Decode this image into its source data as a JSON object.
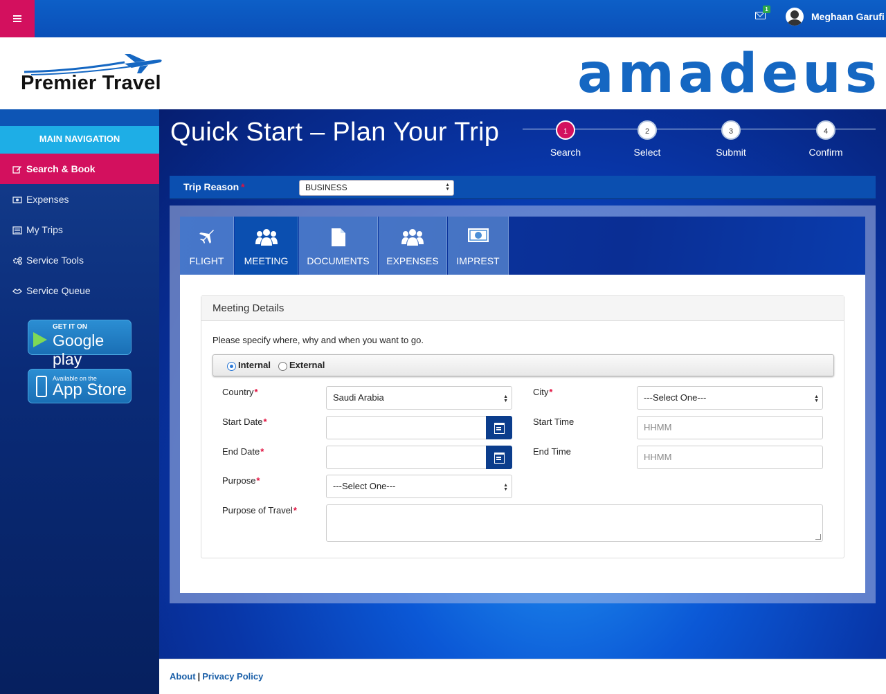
{
  "header": {
    "notification_count": "1",
    "user_name": "Meghaan Garufi"
  },
  "logos": {
    "left_brand": "Premier Travel",
    "right_brand": "amadeus"
  },
  "sidebar": {
    "heading": "MAIN NAVIGATION",
    "items": [
      {
        "label": "Search & Book",
        "icon": "edit-icon",
        "active": true
      },
      {
        "label": "Expenses",
        "icon": "money-icon",
        "active": false
      },
      {
        "label": "My Trips",
        "icon": "list-icon",
        "active": false
      },
      {
        "label": "Service Tools",
        "icon": "cogs-icon",
        "active": false
      },
      {
        "label": "Service Queue",
        "icon": "handshake-icon",
        "active": false
      }
    ],
    "google_play": {
      "small": "GET IT ON",
      "big": "Google play"
    },
    "app_store": {
      "small": "Available on the",
      "big": "App Store"
    }
  },
  "main": {
    "title": "Quick Start – Plan Your Trip",
    "steps": [
      {
        "num": "1",
        "label": "Search",
        "current": true
      },
      {
        "num": "2",
        "label": "Select",
        "current": false
      },
      {
        "num": "3",
        "label": "Submit",
        "current": false
      },
      {
        "num": "4",
        "label": "Confirm",
        "current": false
      }
    ],
    "trip_reason": {
      "label": "Trip Reason",
      "required_mark": "*",
      "value": "BUSINESS"
    },
    "tabs": [
      {
        "label": "FLIGHT",
        "icon": "plane-icon",
        "active": false
      },
      {
        "label": "MEETING",
        "icon": "group-icon",
        "active": true
      },
      {
        "label": "DOCUMENTS",
        "icon": "document-icon",
        "active": false
      },
      {
        "label": "EXPENSES",
        "icon": "group-icon",
        "active": false
      },
      {
        "label": "IMPREST",
        "icon": "money-icon",
        "active": false
      }
    ]
  },
  "meeting": {
    "heading": "Meeting Details",
    "hint": "Please specify where, why and when you want to go.",
    "location_type": {
      "internal": "Internal",
      "external": "External",
      "selected": "Internal"
    },
    "required_mark": "*",
    "country": {
      "label": "Country",
      "value": "Saudi Arabia"
    },
    "city": {
      "label": "City",
      "value": "---Select One---"
    },
    "start_date": {
      "label": "Start Date",
      "value": ""
    },
    "start_time": {
      "label": "Start Time",
      "placeholder": "HHMM"
    },
    "end_date": {
      "label": "End Date",
      "value": ""
    },
    "end_time": {
      "label": "End Time",
      "placeholder": "HHMM"
    },
    "purpose": {
      "label": "Purpose",
      "value": "---Select One---"
    },
    "purpose_of_travel": {
      "label": "Purpose of Travel",
      "value": ""
    }
  },
  "footer": {
    "about": "About",
    "separator": "|",
    "privacy": "Privacy Policy"
  },
  "colors": {
    "accent_pink": "#d3105e",
    "brand_blue": "#1567c2",
    "nav_cyan": "#1eaee6"
  }
}
